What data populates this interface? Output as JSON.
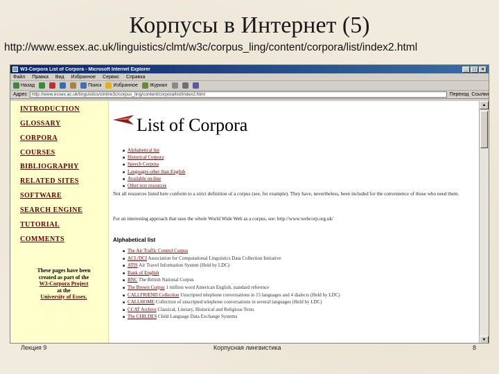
{
  "slide": {
    "title": "Корпусы в Интернет (5)",
    "url": "http://www.essex.ac.uk/linguistics/clmt/w3c/corpus_ling/content/corpora/list/index2.html",
    "footer_left": "Лекция 9",
    "footer_center": "Корпусная лингвистика",
    "footer_right": "8"
  },
  "browser": {
    "window_title": "W3-Corpora List of Corpora - Microsoft Internet Explorer",
    "menu": [
      "Файл",
      "Правка",
      "Вид",
      "Избранное",
      "Сервис",
      "Справка"
    ],
    "toolbar": [
      {
        "label": "Назад",
        "icon": "back-arrow-icon"
      },
      {
        "label": "",
        "icon": "forward-arrow-icon"
      },
      {
        "label": "",
        "icon": "stop-icon"
      },
      {
        "label": "",
        "icon": "refresh-icon"
      },
      {
        "label": "",
        "icon": "home-icon"
      },
      {
        "label": "Поиск",
        "icon": "search-icon"
      },
      {
        "label": "Избранное",
        "icon": "favorites-icon"
      },
      {
        "label": "Журнал",
        "icon": "history-icon"
      },
      {
        "label": "",
        "icon": "mail-icon"
      },
      {
        "label": "",
        "icon": "print-icon"
      },
      {
        "label": "",
        "icon": "edit-icon"
      }
    ],
    "address_label": "Адрес",
    "address_value": "http://www.essex.ac.uk/linguistics/clmt/w3c/corpus_ling/content/corpora/list/index2.html",
    "go_label": "Переход",
    "links_label": "Ссылки"
  },
  "sidebar": {
    "items": [
      "INTRODUCTION",
      "GLOSSARY",
      "CORPORA",
      "COURSES",
      "BIBLIOGRAPHY",
      "RELATED SITES",
      "SOFTWARE",
      "SEARCH ENGINE",
      "TUTORIAL",
      "COMMENTS"
    ],
    "note_line1": "These pages have been",
    "note_line2": "created as part of the",
    "note_link": "W3-Corpora Project",
    "note_line3": "at the",
    "note_link2": "University of Essex."
  },
  "content": {
    "heading": "List of Corpora",
    "toc": [
      "Alphabetical list",
      "Historical Corpora",
      "Speech Corpora",
      "Languages other than English",
      "Available on-line",
      "Other text resources"
    ],
    "para1": "Not all resources listed here conform to a strict definition of a corpus (see, for example). They have, nevertheless, been included for the convenience of those who need them.",
    "para2": "For an interesting approach that uses the whole World Wide Web as a corpus, see: http://www.webcorp.org.uk/",
    "alpha_heading": "Alphabetical list",
    "alpha_items": [
      {
        "link": "The Air Traffic Control Corpus",
        "text": ""
      },
      {
        "link": "ACL/DCI",
        "text": " Association for Computational Linguistics Data Collection Initiative"
      },
      {
        "link": "ATIS",
        "text": " Air Travel Information System (Held by LDC)"
      },
      {
        "link": "Bank of English",
        "text": ""
      },
      {
        "link": "BNC",
        "text": " The British National Corpus"
      },
      {
        "link": "The Brown Corpus",
        "text": " 1 million word American English, standard reference"
      },
      {
        "link": "CALLFRIEND Collection",
        "text": " Unscripted telephone conversations in 15 languages and 4 dialects (Held by LDC)"
      },
      {
        "link": "CALLHOME",
        "text": " Collection of unscripted telephone conversations in several languages (Held by LDC)"
      },
      {
        "link": "CCAT Archive",
        "text": " Classical, Literary, Historical and Religious Texts"
      },
      {
        "link": "The CHILDES",
        "text": " Child Language Data Exchange Systems"
      }
    ]
  },
  "colors": {
    "sidebar_bg": "#ffffcc",
    "nav_link": "#660000",
    "titlebar": "#0a246a",
    "chrome": "#d4d0c8"
  }
}
